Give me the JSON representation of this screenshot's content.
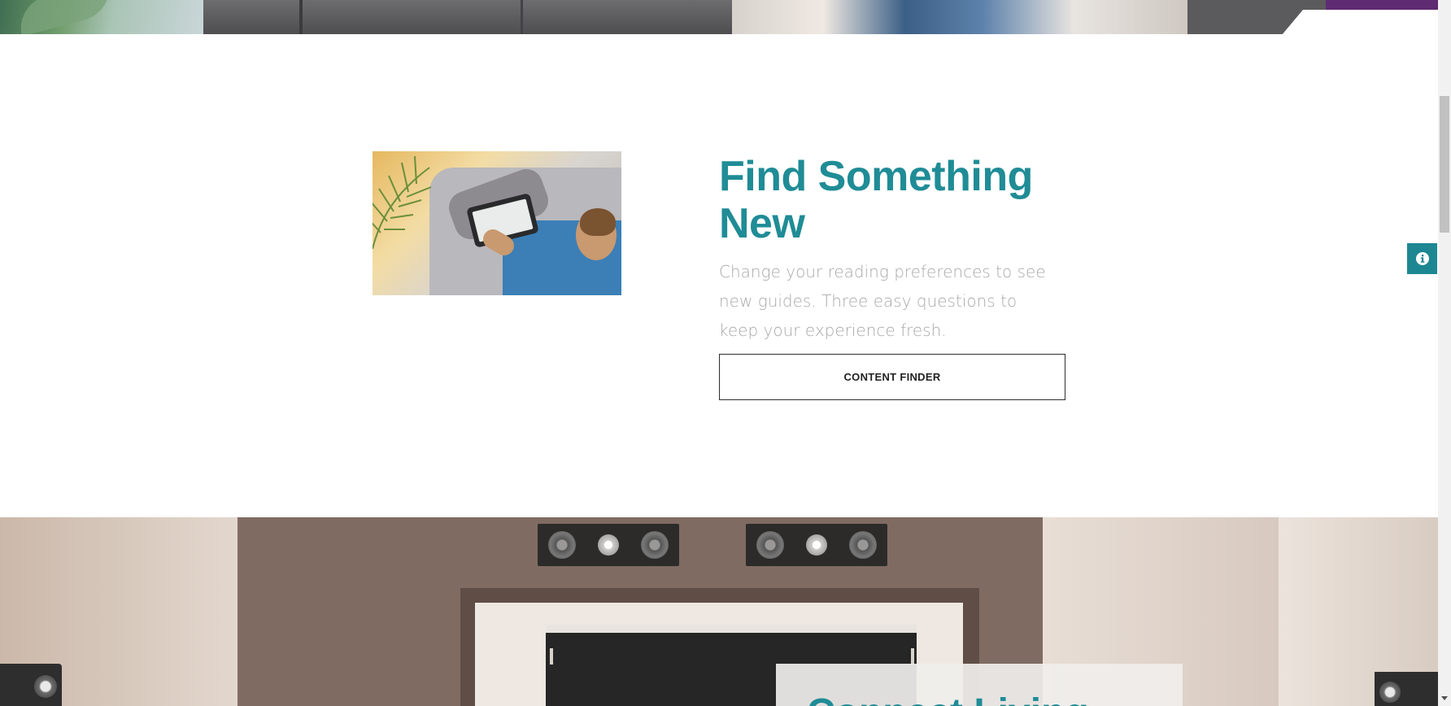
{
  "feature": {
    "title": "Find Something New",
    "description": "Change your reading preferences to see new guides. Three easy questions to keep your experience fresh.",
    "button_label": "CONTENT FINDER"
  },
  "info_tab": {
    "icon": "info-icon"
  },
  "next_section": {
    "title": "Connect Living"
  },
  "colors": {
    "accent": "#1f8c96",
    "info_tab": "#1d8791",
    "purple": "#5f2b73",
    "body_text": "#a9a9a9"
  }
}
